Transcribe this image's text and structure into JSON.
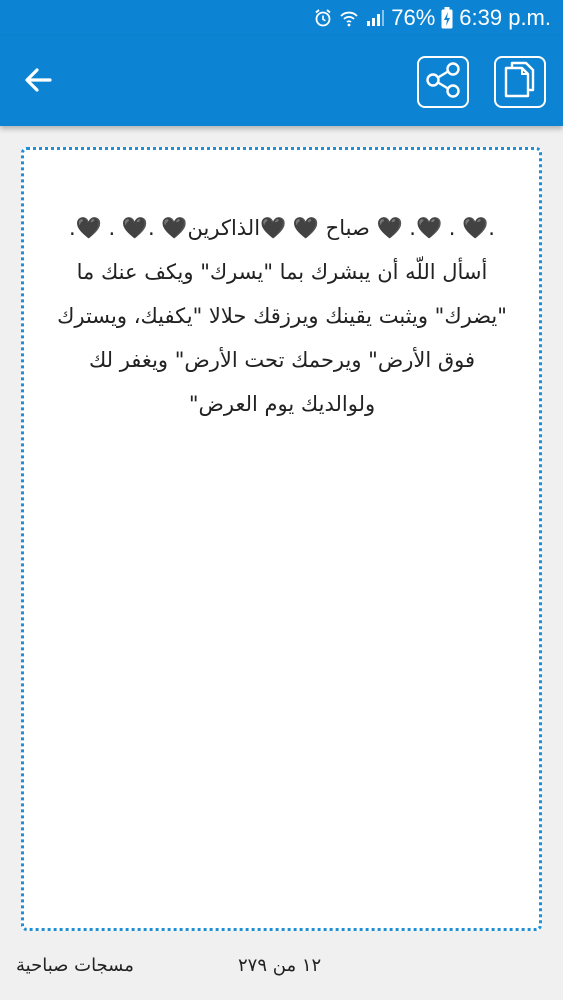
{
  "status_bar": {
    "battery": "76%",
    "time": "6:39 p.m."
  },
  "toolbar": {
    "back_icon": "arrow-left-icon",
    "share_icon": "share-icon",
    "copy_icon": "copy-icon"
  },
  "message": {
    "text": ".🖤 . 🖤. 🖤 صباح 🖤 🖤الذاكرين🖤 .🖤 . 🖤. أسأل اللّه أن يبشرك بما \"يسرك\" ويكف عنك ما \"يضرك\" ويثبت يقينك ويرزقك حلالا \"يكفيك، ويسترك فوق الأرض\" ويرحمك تحت الأرض\" ويغفر لك ولوالديك يوم العرض\""
  },
  "footer": {
    "category": "مسجات صباحية",
    "counter": "١٢ من ٢٧٩"
  },
  "colors": {
    "primary": "#0d84d3",
    "card_border": "#1f8fd6",
    "background": "#f0f0f0"
  }
}
